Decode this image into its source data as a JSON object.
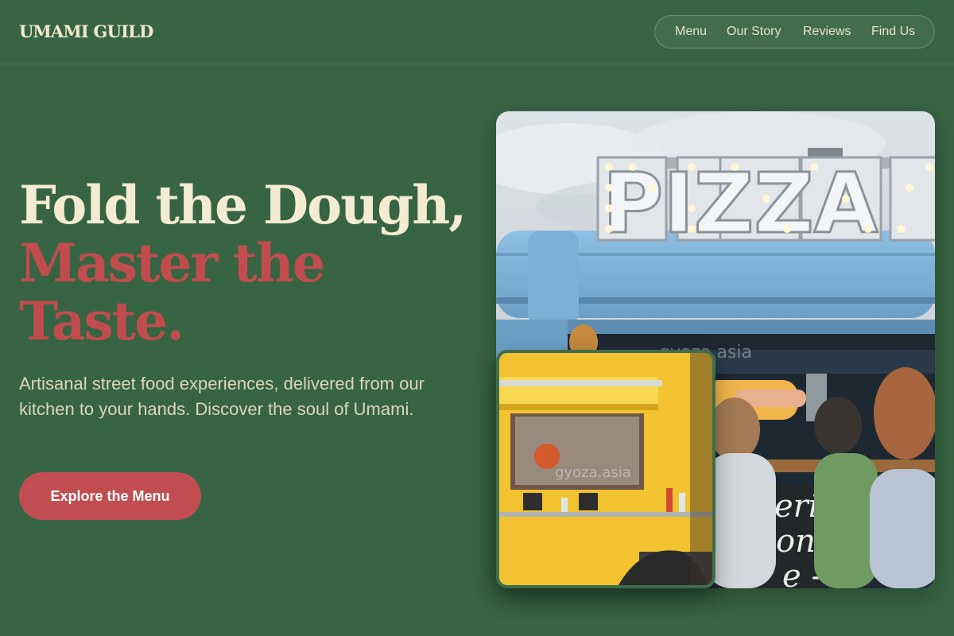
{
  "brand": {
    "name": "UMAMI GUILD"
  },
  "nav": {
    "items": [
      "Menu",
      "Our Story",
      "Reviews",
      "Find Us"
    ]
  },
  "hero": {
    "title_line1": "Fold the Dough,",
    "title_line2": "Master the",
    "title_line3": "Taste.",
    "subtitle": "Artisanal street food experiences, delivered from our kitchen to your hands. Discover the soul of Umami.",
    "cta_label": "Explore the Menu"
  },
  "images": {
    "main": {
      "sign_text": "PIZZA",
      "watermark": "gyoza.asia",
      "chalkboard": "erit oni e -"
    },
    "inset": {
      "watermark": "gyoza.asia"
    }
  },
  "colors": {
    "background": "#376442",
    "title_cream": "#f3ebd2",
    "title_red": "#c04c4e",
    "cta": "#c24d50",
    "truck_blue": "#7fb0d6",
    "truck_yellow": "#f2c230"
  }
}
